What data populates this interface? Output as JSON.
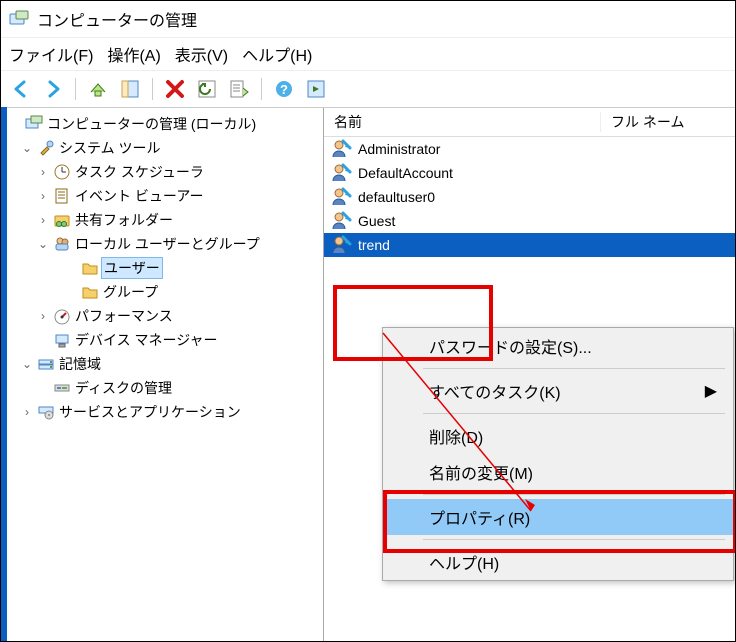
{
  "title": "コンピューターの管理",
  "menus": {
    "file": "ファイル(F)",
    "action": "操作(A)",
    "view": "表示(V)",
    "help": "ヘルプ(H)"
  },
  "tree": {
    "root": "コンピューターの管理 (ローカル)",
    "system_tools": "システム ツール",
    "task_scheduler": "タスク スケジューラ",
    "event_viewer": "イベント ビューアー",
    "shared_folders": "共有フォルダー",
    "local_users_groups": "ローカル ユーザーとグループ",
    "users": "ユーザー",
    "groups": "グループ",
    "performance": "パフォーマンス",
    "device_manager": "デバイス マネージャー",
    "storage": "記憶域",
    "disk_management": "ディスクの管理",
    "services_apps": "サービスとアプリケーション"
  },
  "columns": {
    "name": "名前",
    "fullname": "フル ネーム"
  },
  "users": [
    "Administrator",
    "DefaultAccount",
    "defaultuser0",
    "Guest",
    "trend"
  ],
  "selected_user": "trend",
  "ctx": {
    "set_password": "パスワードの設定(S)...",
    "all_tasks": "すべてのタスク(K)",
    "delete": "削除(D)",
    "rename": "名前の変更(M)",
    "properties": "プロパティ(R)",
    "help": "ヘルプ(H)"
  }
}
